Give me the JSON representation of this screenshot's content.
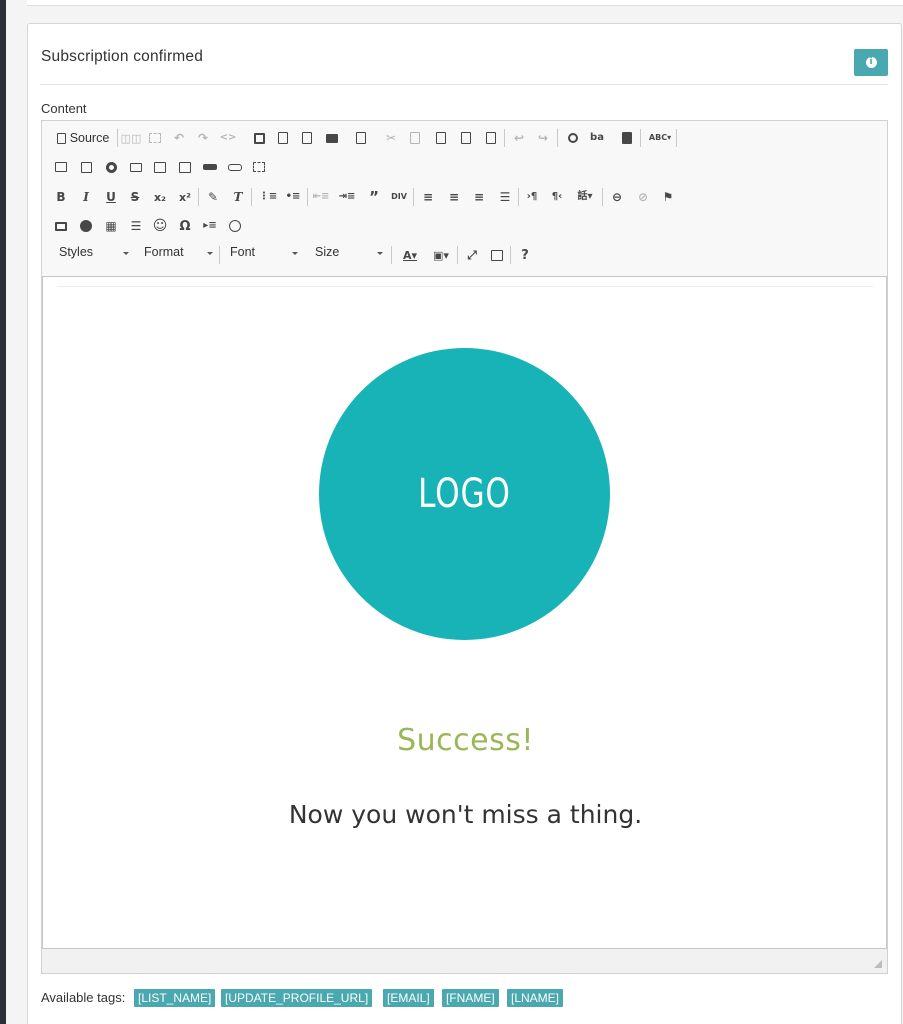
{
  "panel": {
    "title": "Subscription confirmed",
    "info_icon": "info-icon",
    "content_label": "Content"
  },
  "editor": {
    "source_label": "Source",
    "combos": {
      "styles": "Styles",
      "format": "Format",
      "font": "Font",
      "size": "Size"
    },
    "help_label": "?",
    "toolbar_icons": [
      "source-icon",
      "templates-icon",
      "select-all-icon",
      "undo-icon",
      "redo-icon",
      "code-icon",
      "save-icon",
      "new-page-icon",
      "preview-icon",
      "print-icon",
      "templates-list-icon",
      "cut-icon",
      "copy-icon",
      "paste-icon",
      "paste-text-icon",
      "paste-word-icon",
      "undo-arrow-icon",
      "redo-arrow-icon",
      "find-icon",
      "replace-icon",
      "select-block-icon",
      "spellcheck-icon",
      "form-icon",
      "checkbox-icon",
      "radio-icon",
      "textfield-icon",
      "textarea-icon",
      "select-icon",
      "button-icon",
      "image-button-icon",
      "hidden-field-icon",
      "bold-icon",
      "italic-icon",
      "underline-icon",
      "strike-icon",
      "subscript-icon",
      "superscript-icon",
      "copy-format-icon",
      "remove-format-icon",
      "numbered-list-icon",
      "bulleted-list-icon",
      "outdent-icon",
      "indent-icon",
      "blockquote-icon",
      "div-icon",
      "align-left-icon",
      "align-center-icon",
      "align-right-icon",
      "justify-icon",
      "ltr-icon",
      "rtl-icon",
      "language-icon",
      "link-icon",
      "unlink-icon",
      "anchor-icon",
      "image-icon",
      "flash-icon",
      "table-icon",
      "horizontal-line-icon",
      "smiley-icon",
      "special-char-icon",
      "page-break-icon",
      "iframe-icon",
      "text-color-icon",
      "bg-color-icon",
      "maximize-icon",
      "show-blocks-icon",
      "help-icon"
    ],
    "body": {
      "logo_text": "LOGO",
      "logo_color": "#18b3b7",
      "heading": "Success!",
      "heading_color": "#9ab758",
      "subline": "Now you won't miss a thing."
    }
  },
  "tags": {
    "label": "Available tags:",
    "items": [
      "[LIST_NAME]",
      "[UPDATE_PROFILE_URL]",
      "[EMAIL]",
      "[FNAME]",
      "[LNAME]"
    ],
    "color": "#4aa8b0"
  }
}
